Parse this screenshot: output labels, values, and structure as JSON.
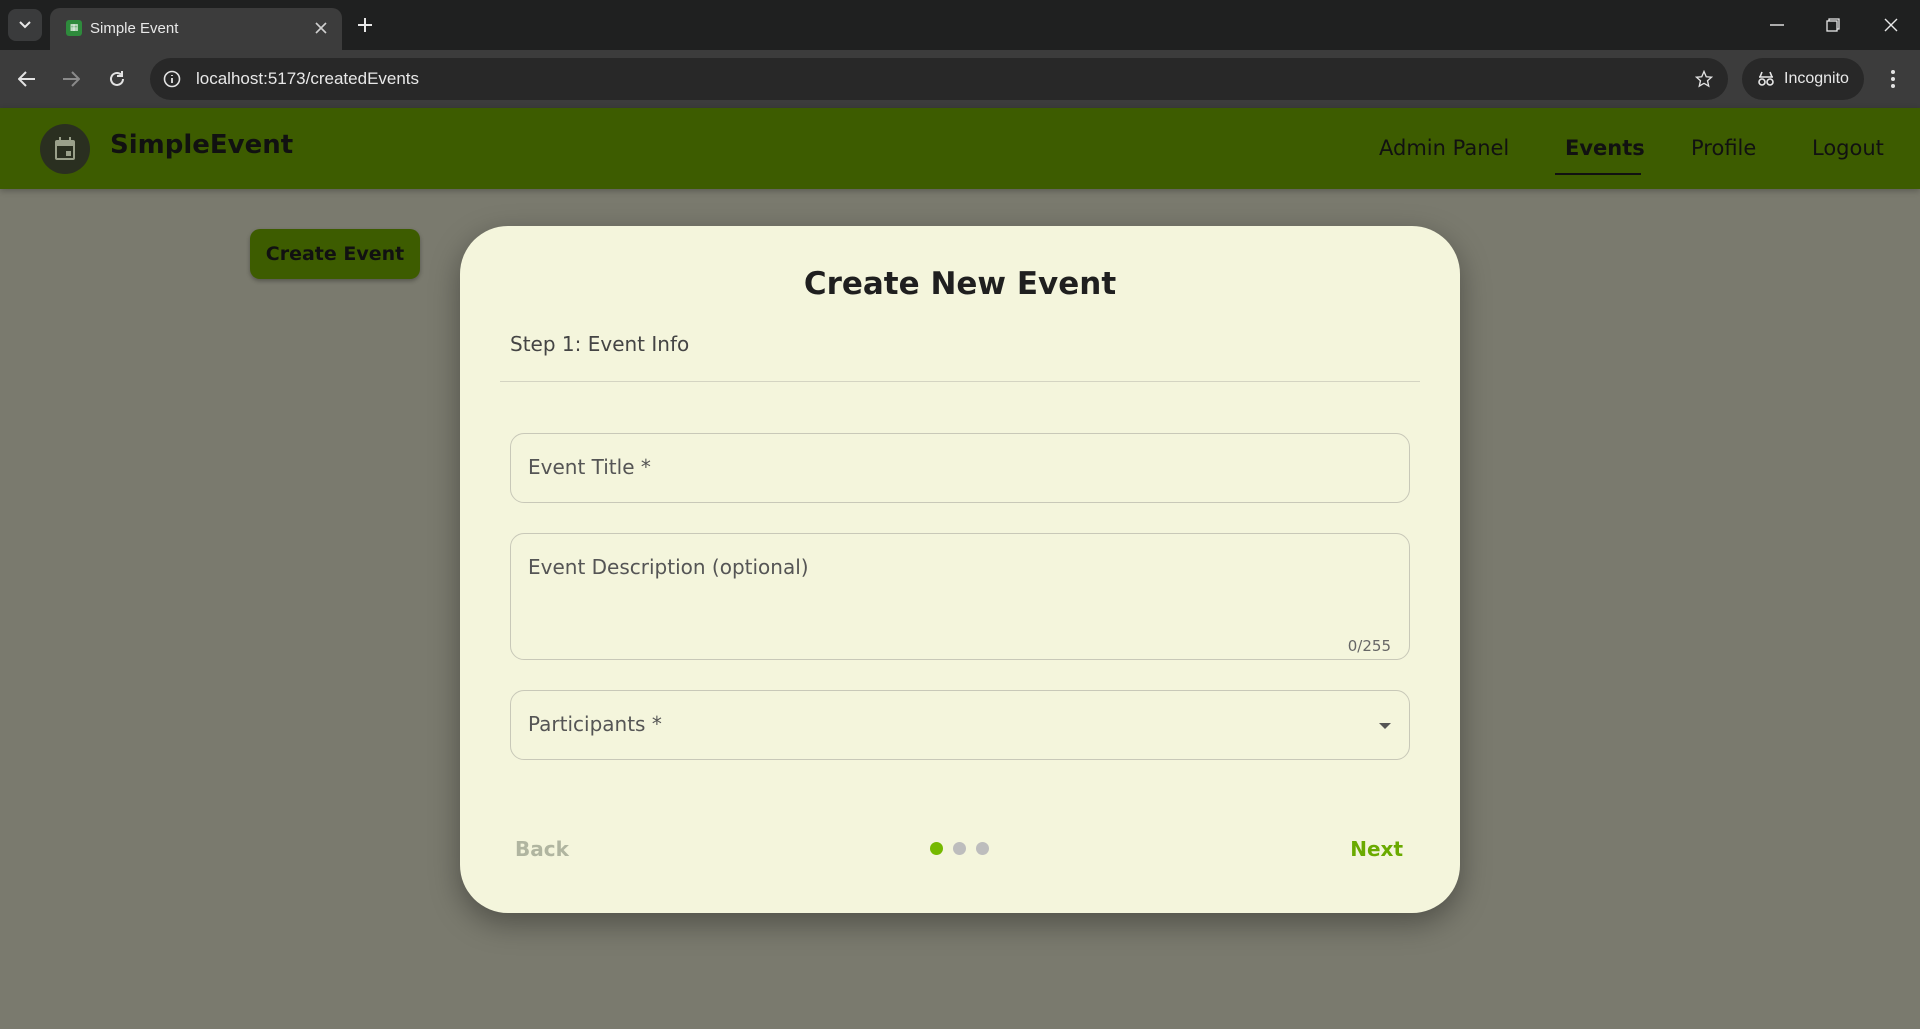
{
  "browser": {
    "tab_title": "Simple Event",
    "url": "localhost:5173/createdEvents",
    "incognito_label": "Incognito"
  },
  "header": {
    "brand": "SimpleEvent",
    "nav": [
      {
        "label": "Admin Panel",
        "active": false
      },
      {
        "label": "Events",
        "active": true
      },
      {
        "label": "Profile",
        "active": false
      },
      {
        "label": "Logout",
        "active": false
      }
    ]
  },
  "page": {
    "create_button": "Create Event"
  },
  "modal": {
    "title": "Create New Event",
    "step": "Step 1: Event Info",
    "fields": {
      "title_label": "Event Title *",
      "description_label": "Event Description (optional)",
      "description_counter": "0/255",
      "participants_label": "Participants *"
    },
    "back": "Back",
    "next": "Next",
    "steps_total": 3,
    "current_step": 1
  },
  "colors": {
    "header": "#3d5c00",
    "modal_bg": "#f4f5dc",
    "accent": "#75b900",
    "backdrop": "#7a7a6e"
  }
}
